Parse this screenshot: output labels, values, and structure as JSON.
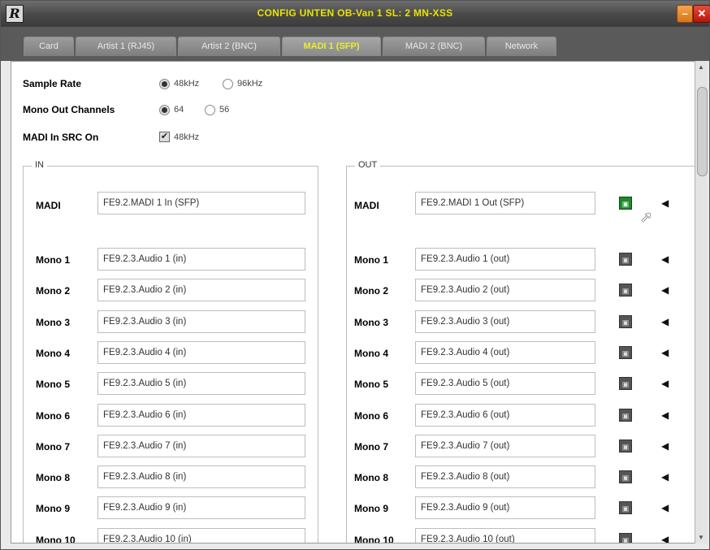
{
  "window": {
    "title": "CONFIG UNTEN OB-Van 1 SL: 2 MN-XSS",
    "logo": "R"
  },
  "tabs": [
    {
      "label": "Card",
      "active": false
    },
    {
      "label": "Artist 1 (RJ45)",
      "active": false
    },
    {
      "label": "Artist 2 (BNC)",
      "active": false
    },
    {
      "label": "MADI 1 (SFP)",
      "active": true
    },
    {
      "label": "MADI 2 (BNC)",
      "active": false
    },
    {
      "label": "Network",
      "active": false
    }
  ],
  "options": {
    "sample_rate": {
      "label": "Sample Rate",
      "choices": [
        "48kHz",
        "96kHz"
      ],
      "selected": "48kHz"
    },
    "mono_out": {
      "label": "Mono Out Channels",
      "choices": [
        "64",
        "56"
      ],
      "selected": "64"
    },
    "madi_src": {
      "label": "MADI In SRC On",
      "checkbox_text": "48kHz",
      "checked": true
    }
  },
  "in_group": {
    "title": "IN",
    "madi": {
      "label": "MADI",
      "value": "FE9.2.MADI 1 In (SFP)"
    },
    "rows": [
      {
        "label": "Mono 1",
        "value": "FE9.2.3.Audio 1 (in)"
      },
      {
        "label": "Mono 2",
        "value": "FE9.2.3.Audio 2 (in)"
      },
      {
        "label": "Mono 3",
        "value": "FE9.2.3.Audio 3 (in)"
      },
      {
        "label": "Mono 4",
        "value": "FE9.2.3.Audio 4 (in)"
      },
      {
        "label": "Mono 5",
        "value": "FE9.2.3.Audio 5 (in)"
      },
      {
        "label": "Mono 6",
        "value": "FE9.2.3.Audio 6 (in)"
      },
      {
        "label": "Mono 7",
        "value": "FE9.2.3.Audio 7 (in)"
      },
      {
        "label": "Mono 8",
        "value": "FE9.2.3.Audio 8 (in)"
      },
      {
        "label": "Mono 9",
        "value": "FE9.2.3.Audio 9 (in)"
      },
      {
        "label": "Mono 10",
        "value": "FE9.2.3.Audio 10 (in)"
      }
    ]
  },
  "out_group": {
    "title": "OUT",
    "madi": {
      "label": "MADI",
      "value": "FE9.2.MADI 1 Out (SFP)"
    },
    "rows": [
      {
        "label": "Mono 1",
        "value": "FE9.2.3.Audio 1 (out)"
      },
      {
        "label": "Mono 2",
        "value": "FE9.2.3.Audio 2 (out)"
      },
      {
        "label": "Mono 3",
        "value": "FE9.2.3.Audio 3 (out)"
      },
      {
        "label": "Mono 4",
        "value": "FE9.2.3.Audio 4 (out)"
      },
      {
        "label": "Mono 5",
        "value": "FE9.2.3.Audio 5 (out)"
      },
      {
        "label": "Mono 6",
        "value": "FE9.2.3.Audio 6 (out)"
      },
      {
        "label": "Mono 7",
        "value": "FE9.2.3.Audio 7 (out)"
      },
      {
        "label": "Mono 8",
        "value": "FE9.2.3.Audio 8 (out)"
      },
      {
        "label": "Mono 9",
        "value": "FE9.2.3.Audio 9 (out)"
      },
      {
        "label": "Mono 10",
        "value": "FE9.2.3.Audio 10 (out)"
      }
    ]
  },
  "icons": {
    "lock": "lock-toggle-icon",
    "speaker": "speaker-icon",
    "cursor": "mouse-pointer-icon"
  },
  "colors": {
    "title_text": "#e8e400",
    "active_tab_text": "#ecec30",
    "lock_active": "#1e8a2a",
    "close_button": "#c8200f"
  }
}
